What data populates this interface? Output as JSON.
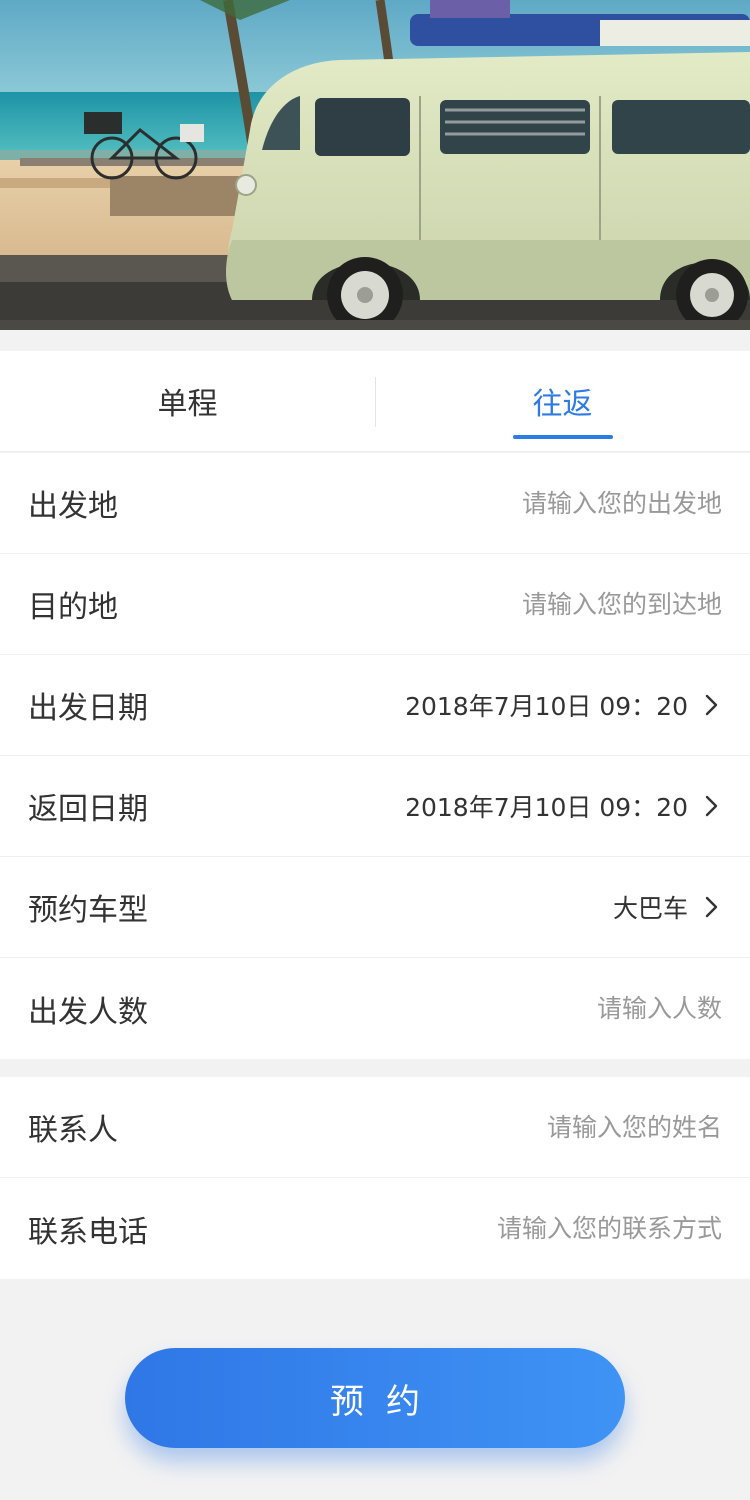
{
  "tabs": [
    {
      "label": "单程",
      "active": false
    },
    {
      "label": "往返",
      "active": true
    }
  ],
  "form": {
    "departure": {
      "label": "出发地",
      "placeholder": "请输入您的出发地"
    },
    "destination": {
      "label": "目的地",
      "placeholder": "请输入您的到达地"
    },
    "depart_date": {
      "label": "出发日期",
      "value": "2018年7月10日 09：20"
    },
    "return_date": {
      "label": "返回日期",
      "value": "2018年7月10日 09：20"
    },
    "vehicle_type": {
      "label": "预约车型",
      "value": "大巴车"
    },
    "passengers": {
      "label": "出发人数",
      "placeholder": "请输入人数"
    }
  },
  "contact": {
    "name": {
      "label": "联系人",
      "placeholder": "请输入您的姓名"
    },
    "phone": {
      "label": "联系电话",
      "placeholder": "请输入您的联系方式"
    }
  },
  "submit_label": "预约",
  "colors": {
    "accent": "#2d7be5",
    "background": "#f2f2f2"
  }
}
